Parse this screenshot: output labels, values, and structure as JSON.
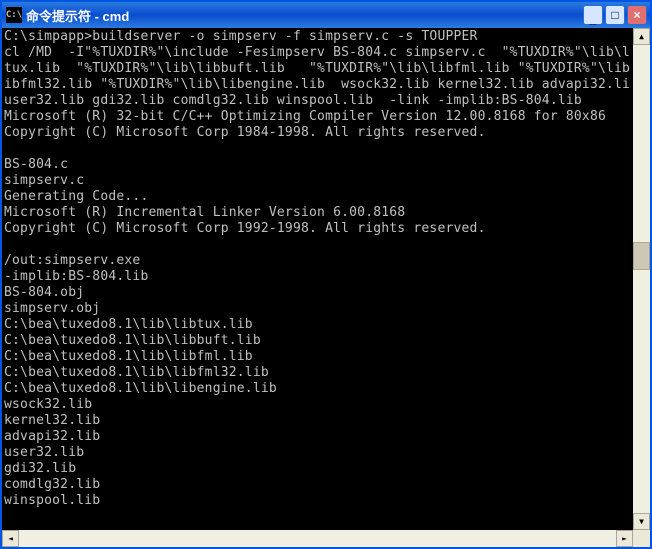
{
  "window": {
    "icon_text": "C:\\",
    "title": "命令提示符 - cmd"
  },
  "terminal_lines": [
    "C:\\simpapp>buildserver -o simpserv -f simpserv.c -s TOUPPER",
    "cl /MD  -I\"%TUXDIR%\"\\include -Fesimpserv BS-804.c simpserv.c  \"%TUXDIR%\"\\lib\\l",
    "tux.lib  \"%TUXDIR%\"\\lib\\libbuft.lib   \"%TUXDIR%\"\\lib\\libfml.lib \"%TUXDIR%\"\\lib",
    "ibfml32.lib \"%TUXDIR%\"\\lib\\libengine.lib  wsock32.lib kernel32.lib advapi32.li",
    "user32.lib gdi32.lib comdlg32.lib winspool.lib  -link -implib:BS-804.lib",
    "Microsoft (R) 32-bit C/C++ Optimizing Compiler Version 12.00.8168 for 80x86",
    "Copyright (C) Microsoft Corp 1984-1998. All rights reserved.",
    "",
    "BS-804.c",
    "simpserv.c",
    "Generating Code...",
    "Microsoft (R) Incremental Linker Version 6.00.8168",
    "Copyright (C) Microsoft Corp 1992-1998. All rights reserved.",
    "",
    "/out:simpserv.exe",
    "-implib:BS-804.lib",
    "BS-804.obj",
    "simpserv.obj",
    "C:\\bea\\tuxedo8.1\\lib\\libtux.lib",
    "C:\\bea\\tuxedo8.1\\lib\\libbuft.lib",
    "C:\\bea\\tuxedo8.1\\lib\\libfml.lib",
    "C:\\bea\\tuxedo8.1\\lib\\libfml32.lib",
    "C:\\bea\\tuxedo8.1\\lib\\libengine.lib",
    "wsock32.lib",
    "kernel32.lib",
    "advapi32.lib",
    "user32.lib",
    "gdi32.lib",
    "comdlg32.lib",
    "winspool.lib",
    ""
  ]
}
